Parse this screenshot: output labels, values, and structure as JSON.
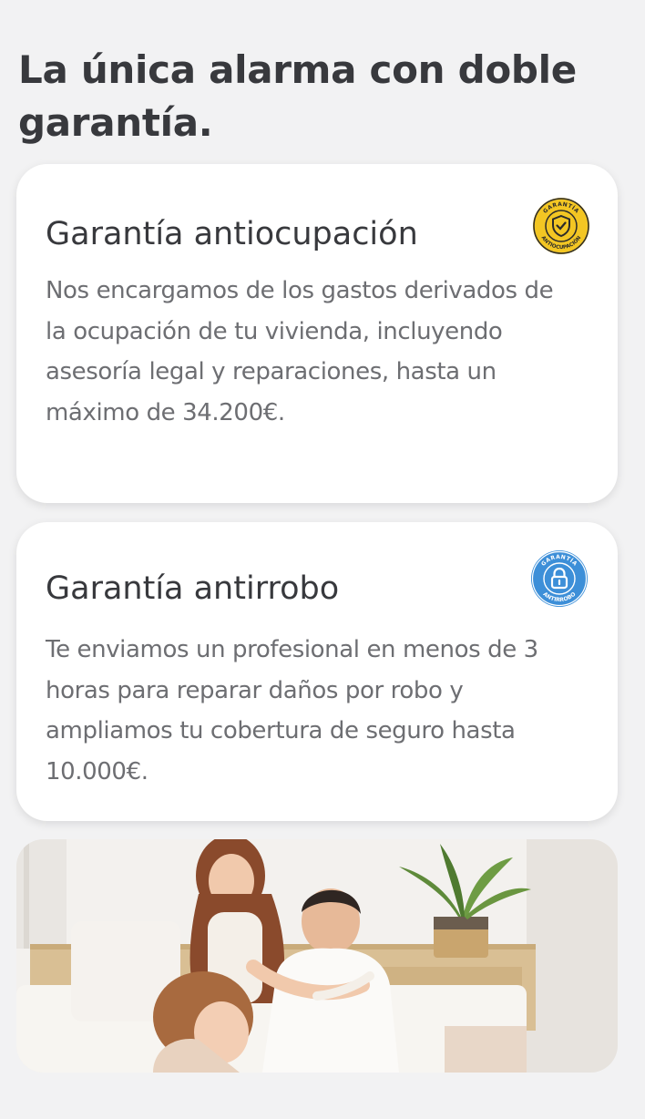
{
  "headline": "La única alarma con doble garantía.",
  "cards": [
    {
      "title": "Garantía antiocupación",
      "text": "Nos encargamos de los gastos derivados de la ocupación de tu vivienda, incluyendo asesoría legal y reparaciones, hasta un máximo de 34.200€.",
      "badge": {
        "icon": "shield-check-icon",
        "top_text": "GARANTÍA",
        "bottom_text": "ANTIOCUPACIÓN",
        "color": "#f3c623"
      }
    },
    {
      "title": "Garantía antirrobo",
      "text": "Te enviamos un profesional en menos de 3 horas para reparar daños por robo y ampliamos tu cobertura de seguro hasta 10.000€.",
      "badge": {
        "icon": "padlock-icon",
        "top_text": "GARANTÍA",
        "bottom_text": "ANTIRROBO",
        "color": "#3d8fd8"
      }
    }
  ],
  "photo": {
    "icon": "family-photo"
  }
}
